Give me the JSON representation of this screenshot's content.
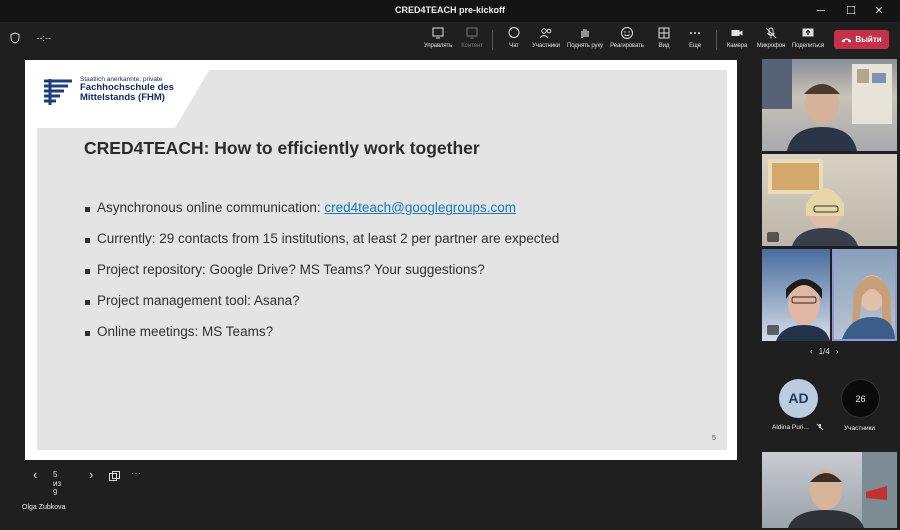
{
  "window": {
    "title": "CRED4TEACH pre-kickoff",
    "minimize": "─",
    "maximize": "☐",
    "close": "✕"
  },
  "toolbar": {
    "timer": "--:--",
    "buttons": {
      "manage": "Управлять",
      "content": "Контент",
      "chat": "Чат",
      "participants": "Участники",
      "raise_hand": "Поднять руку",
      "react": "Реагировать",
      "view": "Вид",
      "more": "Еще",
      "camera": "Камера",
      "mic": "Микрофон",
      "share": "Поделиться"
    },
    "leave_label": "Выйти"
  },
  "slide": {
    "logo": {
      "line1": "Staatlich anerkannte, private",
      "line2": "Fachhochschule des",
      "line3": "Mittelstands (FHM)",
      "mark": "FHM"
    },
    "title": "CRED4TEACH: How to efficiently work together",
    "bullets": {
      "b1_text": "Asynchronous online communication: ",
      "b1_link": "cred4teach@googlegroups.com",
      "b2": "Currently: 29 contacts from 15 institutions, at least 2 per partner are expected",
      "b3": "Project repository: Google Drive? MS Teams? Your suggestions?",
      "b4": "Project management tool: Asana?",
      "b5": "Online meetings: MS Teams?"
    },
    "page_number": "5"
  },
  "slide_nav": {
    "position": "5 из 9",
    "prev": "‹",
    "next": "›",
    "more": "···"
  },
  "presenter": "Olga Zubkova",
  "participants_panel": {
    "pager": "1/4",
    "avatar1_initials": "AD",
    "avatar1_name": "Aldina Puri...",
    "avatar2_count": "26",
    "avatar2_label": "Участники"
  },
  "colors": {
    "leave_button": "#c4314b",
    "link": "#1a7ab8",
    "slide_bg": "#e4e4e4"
  }
}
